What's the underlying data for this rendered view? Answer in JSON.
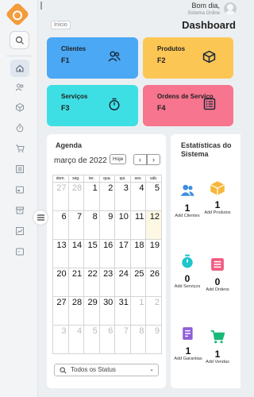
{
  "app": {
    "user_greeting": "Bom dia,",
    "user_status": "Sistema Online",
    "breadcrumb": "Início",
    "page_title": "Dashboard"
  },
  "cards": [
    {
      "title": "Clientes",
      "key": "F1",
      "icon": "users-icon",
      "color": "#4aa8f5"
    },
    {
      "title": "Produtos",
      "key": "F2",
      "icon": "box-icon",
      "color": "#fcc655"
    },
    {
      "title": "Serviços",
      "key": "F3",
      "icon": "stopwatch-icon",
      "color": "#3edfe4"
    },
    {
      "title": "Ordens de Serviço",
      "key": "F4",
      "icon": "list-icon",
      "color": "#f7758e"
    }
  ],
  "agenda": {
    "title": "Agenda",
    "month": "março de 2022",
    "today_button": "Hoje",
    "prev": "‹",
    "next": "›",
    "weekdays": [
      "dom.",
      "seg.",
      "ter.",
      "qua.",
      "qui.",
      "sex.",
      "sáb."
    ],
    "weeks": [
      [
        "27",
        "28",
        "1",
        "2",
        "3",
        "4",
        "5"
      ],
      [
        "6",
        "7",
        "8",
        "9",
        "10",
        "11",
        "12"
      ],
      [
        "13",
        "14",
        "15",
        "16",
        "17",
        "18",
        "19"
      ],
      [
        "20",
        "21",
        "22",
        "23",
        "24",
        "25",
        "26"
      ],
      [
        "27",
        "28",
        "29",
        "30",
        "31",
        "1",
        "2"
      ],
      [
        "3",
        "4",
        "5",
        "6",
        "7",
        "8",
        "9"
      ]
    ],
    "filter": "Todos os Status"
  },
  "stats": {
    "title": "Estatísticas do Sistema",
    "items": [
      {
        "count": "1",
        "label": "Add Clientes",
        "icon": "users-icon",
        "color": "#3d8fe0"
      },
      {
        "count": "1",
        "label": "Add Produtos",
        "icon": "box-icon",
        "color": "#f6b73c"
      },
      {
        "count": "0",
        "label": "Add Serviços",
        "icon": "stopwatch-icon",
        "color": "#1cc6cc"
      },
      {
        "count": "0",
        "label": "Add Ordens",
        "icon": "list-icon",
        "color": "#f05a7e"
      },
      {
        "count": "1",
        "label": "Add Garantias",
        "icon": "document-icon",
        "color": "#8e5ed8"
      },
      {
        "count": "1",
        "label": "Add Vendas",
        "icon": "cart-icon",
        "color": "#17b978"
      }
    ]
  }
}
